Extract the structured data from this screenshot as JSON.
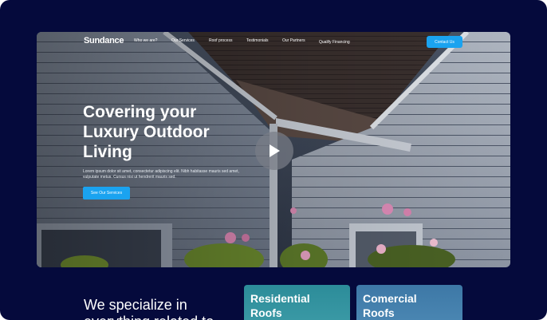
{
  "nav": {
    "logo": "Sundance",
    "links": [
      "Who we are?",
      "Our Services",
      "Roof process",
      "Testimonials",
      "Our Partners",
      "Qualify Financing"
    ],
    "contact_label": "Contact Us"
  },
  "hero": {
    "title_lines": [
      "Covering your",
      "Luxury Outdoor",
      "Living"
    ],
    "body": "Lorem ipsum dolor sit amet, consectetur adipiscing elit. Nibh habitasse mauris sed amet, vulputate metus. Cursus nisi ut hendrerit mauris sed.",
    "cta_label": "See Our Services",
    "play_icon": "play-icon"
  },
  "specialize": {
    "text_lines": [
      "We specialize in",
      "everything related to"
    ]
  },
  "cards": [
    {
      "title_lines": [
        "Residential",
        "Roofs"
      ]
    },
    {
      "title_lines": [
        "Comercial",
        "Roofs"
      ]
    }
  ],
  "colors": {
    "background": "#050a3c",
    "accent": "#1aa3f0",
    "card_residential": "#2c8c99",
    "card_commercial": "#3d78a6"
  }
}
